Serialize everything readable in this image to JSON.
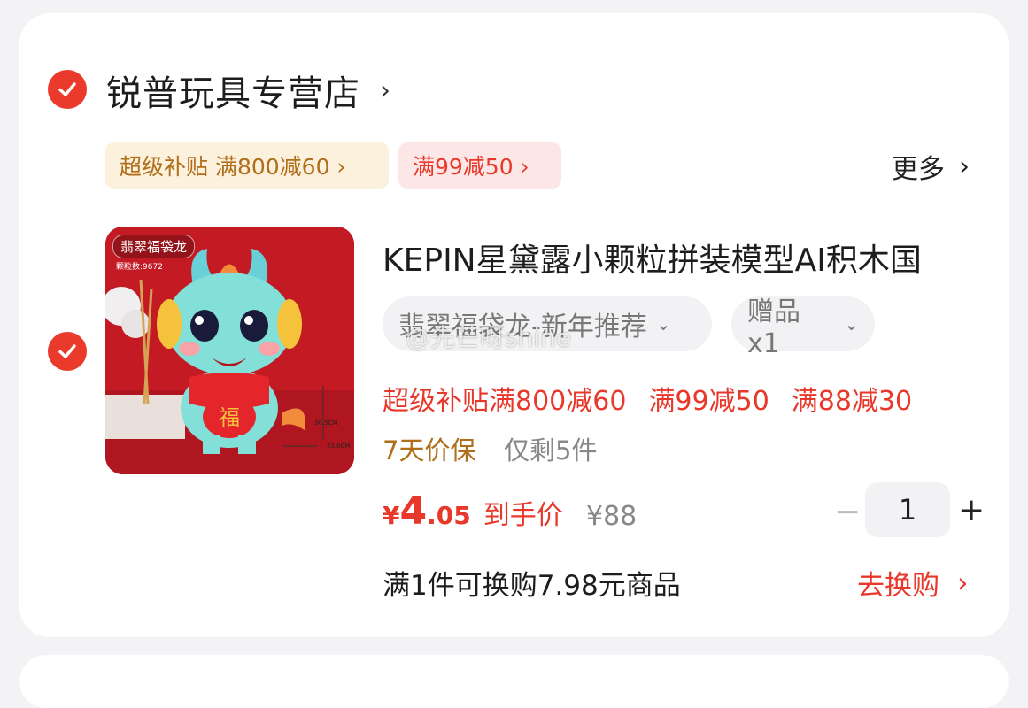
{
  "store": {
    "name": "锐普玩具专营店",
    "chevron": "›",
    "tags": [
      {
        "label": "超级补贴 满800减60 ›"
      },
      {
        "label": "满99减50 ›"
      }
    ],
    "more_label": "更多",
    "more_chevron": "›"
  },
  "product": {
    "image_label": "翡翠福袋龙",
    "image_sub": "颗粒数:9672",
    "dim_height": "30.5CM",
    "dim_width": "23.0CM",
    "title": "KEPIN星黛露小颗粒拼装模型AI积木国",
    "spec_label": "翡翠福袋龙-新年推荐",
    "spec_chevron": "⌄",
    "gift_label": "赠品 x1",
    "gift_chevron": "⌄",
    "promos": [
      "超级补贴满800减60",
      "满99减50",
      "满88减30"
    ],
    "guarantee": "7天价保",
    "stock": "仅剩5件",
    "price_symbol": "¥",
    "price_int": "4",
    "price_dec": ".05",
    "price_label": "到手价",
    "original_price": "¥88",
    "quantity": "1",
    "minus": "−",
    "plus": "+",
    "exchange_text": "满1件可换购7.98元商品",
    "exchange_action": "去换购",
    "exchange_chevron": "›"
  },
  "watermark": "@先芒呀shine",
  "colors": {
    "accent_red": "#e8382b",
    "check_red": "#ea3a2c",
    "gold": "#b06d1a"
  }
}
